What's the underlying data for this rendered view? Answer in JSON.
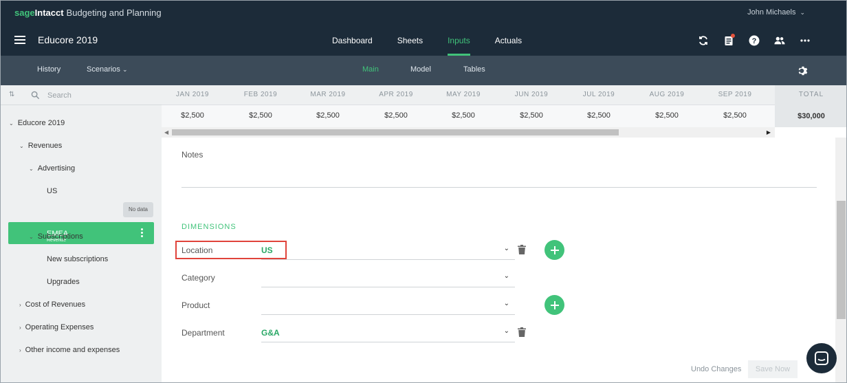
{
  "brand": {
    "sage": "sage",
    "intacct": "Intacct",
    "product": "Budgeting and Planning"
  },
  "user": {
    "name": "John Michaels"
  },
  "app": {
    "title": "Educore 2019"
  },
  "nav": {
    "tabs": [
      {
        "label": "Dashboard"
      },
      {
        "label": "Sheets"
      },
      {
        "label": "Inputs",
        "active": true
      },
      {
        "label": "Actuals"
      }
    ],
    "icons": [
      "sync-icon",
      "clipboard-icon",
      "help-icon",
      "people-icon",
      "more-icon"
    ]
  },
  "subnav": {
    "history": "History",
    "scenarios": "Scenarios",
    "tabs": [
      {
        "label": "Main",
        "active": true
      },
      {
        "label": "Model"
      },
      {
        "label": "Tables"
      }
    ]
  },
  "sidebar": {
    "search_placeholder": "Search",
    "items": [
      {
        "label": "Educore 2019"
      },
      {
        "label": "Revenues"
      },
      {
        "label": "Advertising"
      },
      {
        "label": "US"
      },
      {
        "label": "EMEA",
        "sublabel": "Revenue",
        "selected": true
      },
      {
        "label": "Subscriptions"
      },
      {
        "label": "New subscriptions"
      },
      {
        "label": "Upgrades"
      },
      {
        "label": "Cost of Revenues"
      },
      {
        "label": "Operating Expenses"
      },
      {
        "label": "Other income and expenses"
      }
    ],
    "no_data_badge": "No data"
  },
  "grid": {
    "months": [
      "JAN 2019",
      "FEB 2019",
      "MAR 2019",
      "APR 2019",
      "MAY 2019",
      "JUN 2019",
      "JUL 2019",
      "AUG 2019",
      "SEP 2019"
    ],
    "values": [
      "$2,500",
      "$2,500",
      "$2,500",
      "$2,500",
      "$2,500",
      "$2,500",
      "$2,500",
      "$2,500",
      "$2,500"
    ],
    "total_label": "TOTAL",
    "total_value": "$30,000"
  },
  "notes": {
    "label": "Notes"
  },
  "dimensions": {
    "title": "DIMENSIONS",
    "rows": [
      {
        "label": "Location",
        "value": "US"
      },
      {
        "label": "Category",
        "value": ""
      },
      {
        "label": "Product",
        "value": ""
      },
      {
        "label": "Department",
        "value": "G&A"
      }
    ]
  },
  "footer": {
    "undo": "Undo Changes",
    "save": "Save Now"
  },
  "colors": {
    "accent": "#41c37a",
    "navbar": "#1c2b39",
    "subnav": "#3c4b59",
    "highlight": "#e0433a"
  }
}
